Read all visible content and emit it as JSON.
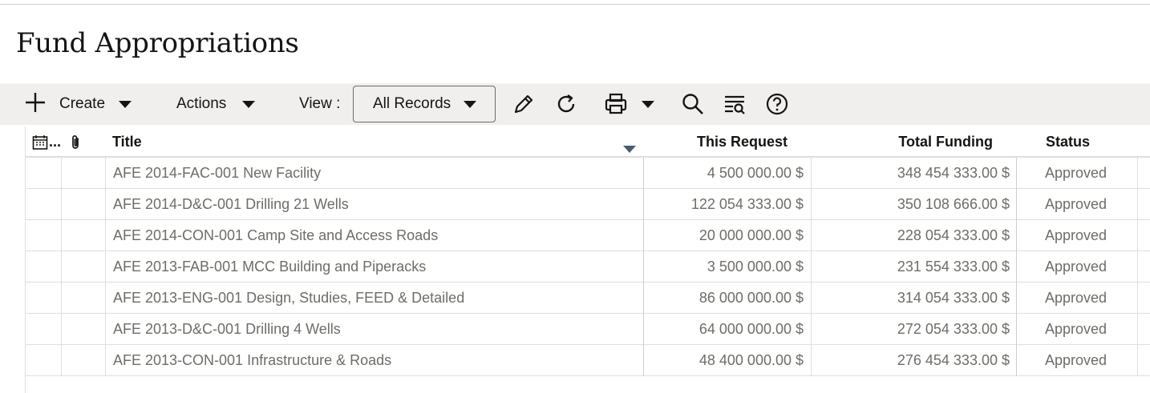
{
  "page": {
    "title": "Fund Appropriations"
  },
  "toolbar": {
    "create_label": "Create",
    "actions_label": "Actions",
    "view_label": "View :",
    "view_selected": "All Records",
    "icons": [
      "plus-icon",
      "chevron-down-icon",
      "pencil-icon",
      "refresh-icon",
      "printer-icon",
      "search-icon",
      "filter-list-icon",
      "help-icon"
    ]
  },
  "table": {
    "columns": {
      "calendar_ellipsis": "...",
      "title": "Title",
      "this_request": "This Request",
      "total_funding": "Total Funding",
      "status": "Status"
    },
    "sorted_column": "Title",
    "rows": [
      {
        "title": "AFE 2014-FAC-001 New Facility",
        "this_request": "4 500 000.00 $",
        "total_funding": "348 454 333.00 $",
        "status": "Approved"
      },
      {
        "title": "AFE 2014-D&C-001 Drilling 21 Wells",
        "this_request": "122 054 333.00 $",
        "total_funding": "350 108 666.00 $",
        "status": "Approved"
      },
      {
        "title": "AFE 2014-CON-001 Camp Site and Access Roads",
        "this_request": "20 000 000.00 $",
        "total_funding": "228 054 333.00 $",
        "status": "Approved"
      },
      {
        "title": "AFE 2013-FAB-001 MCC Building and Piperacks",
        "this_request": "3 500 000.00 $",
        "total_funding": "231 554 333.00 $",
        "status": "Approved"
      },
      {
        "title": "AFE 2013-ENG-001 Design, Studies, FEED & Detailed",
        "this_request": "86 000 000.00 $",
        "total_funding": "314 054 333.00 $",
        "status": "Approved"
      },
      {
        "title": "AFE 2013-D&C-001 Drilling 4 Wells",
        "this_request": "64 000 000.00 $",
        "total_funding": "272 054 333.00 $",
        "status": "Approved"
      },
      {
        "title": "AFE 2013-CON-001 Infrastructure & Roads",
        "this_request": "48 400 000.00 $",
        "total_funding": "276 454 333.00 $",
        "status": "Approved"
      }
    ]
  }
}
